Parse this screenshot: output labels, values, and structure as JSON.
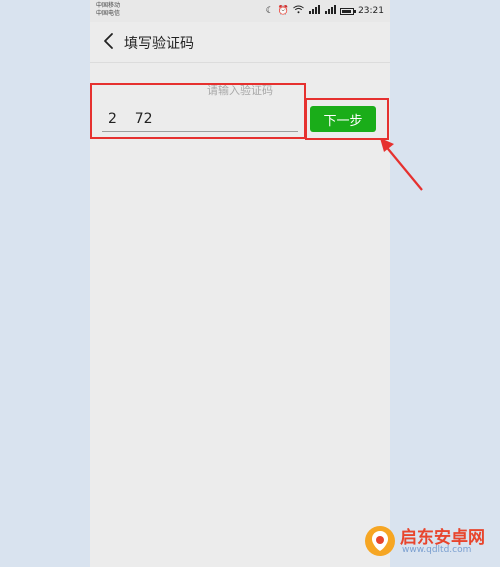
{
  "status_bar": {
    "carrier_1": "中国移动",
    "carrier_2": "中国电信",
    "time": "23:21"
  },
  "nav": {
    "title": "填写验证码",
    "back_icon": "chevron-left-icon"
  },
  "form": {
    "prompt": "请输入验证码",
    "code_value": "2    72",
    "next_label": "下一步"
  },
  "watermark": {
    "name": "启东安卓网",
    "url": "www.qdltd.com"
  },
  "colors": {
    "accent": "#1aad19",
    "highlight": "#e6312f",
    "background": "#ececec"
  }
}
